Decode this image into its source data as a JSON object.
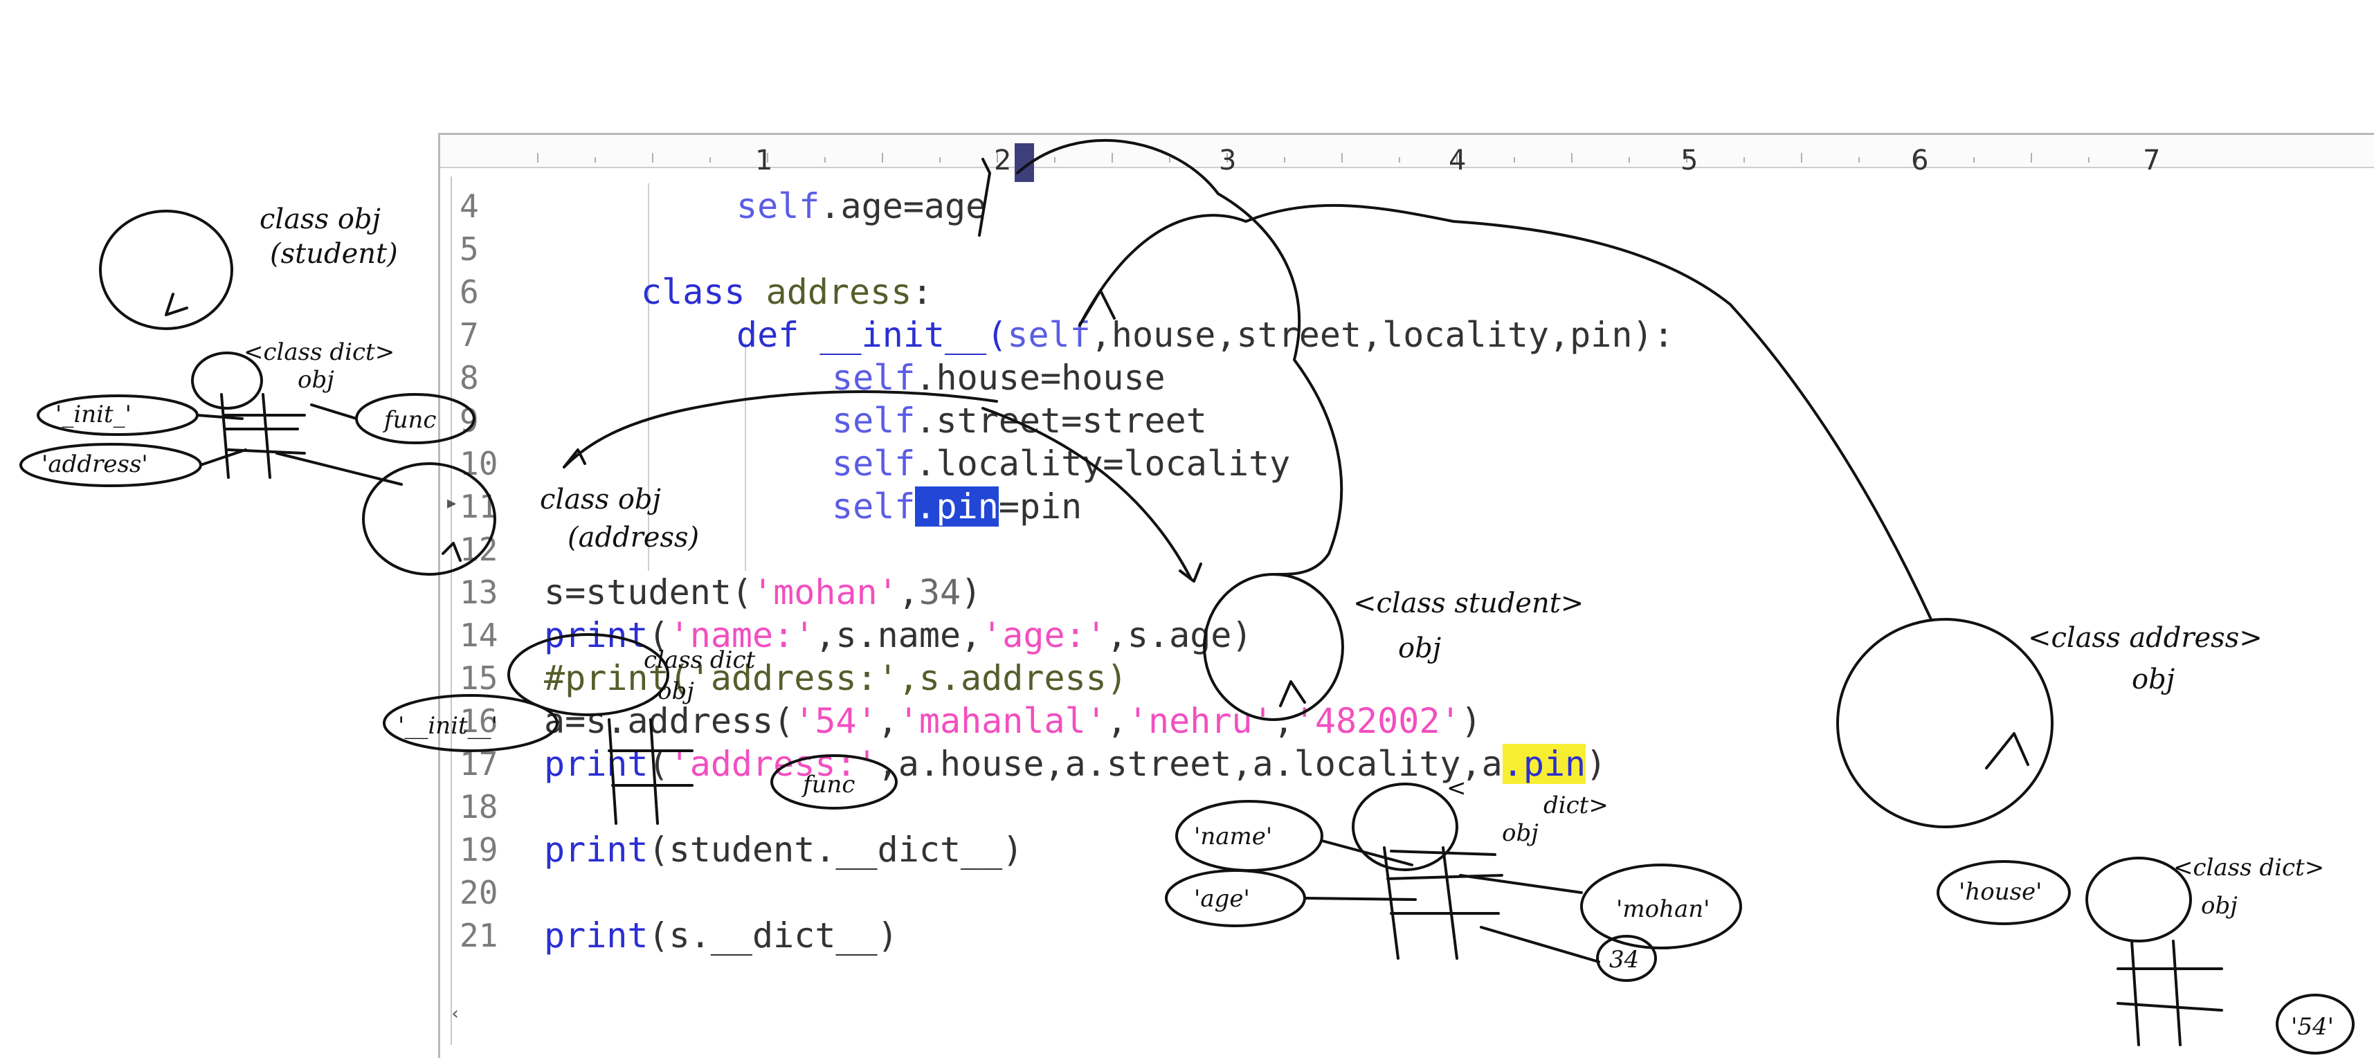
{
  "ruler": {
    "numbers": [
      "1",
      "2",
      "3",
      "4",
      "5",
      "6",
      "7"
    ]
  },
  "lines": [
    {
      "num": "4"
    },
    {
      "num": "5"
    },
    {
      "num": "6"
    },
    {
      "num": "7"
    },
    {
      "num": "8"
    },
    {
      "num": "9"
    },
    {
      "num": "10"
    },
    {
      "num": "11"
    },
    {
      "num": "12"
    },
    {
      "num": "13"
    },
    {
      "num": "14"
    },
    {
      "num": "15"
    },
    {
      "num": "16"
    },
    {
      "num": "17"
    },
    {
      "num": "18"
    },
    {
      "num": "19"
    },
    {
      "num": "20"
    },
    {
      "num": "21"
    }
  ],
  "code": {
    "l4_self": "self",
    "l4_rest": ".age=age",
    "l6_kw": "class",
    "l6_name": " address",
    "l6_colon": ":",
    "l7_kw": "def",
    "l7_name": " __init__(",
    "l7_self": "self",
    "l7_rest": ",house,street,locality,pin):",
    "l8_self": "self",
    "l8_rest": ".house=house",
    "l9_self": "self",
    "l9_rest": ".street=street",
    "l10_self": "self",
    "l10_rest": ".locality=locality",
    "l11_self": "self",
    "l11_sel": ".pin",
    "l11_rest": "=pin",
    "l13_a": "s=student(",
    "l13_s": "'mohan'",
    "l13_b": ",",
    "l13_n": "34",
    "l13_c": ")",
    "l14_kw": "print",
    "l14_a": "(",
    "l14_s1": "'name:'",
    "l14_b": ",s.name,",
    "l14_s2": "'age:'",
    "l14_c": ",s.age)",
    "l15": "#print('address:',s.address)",
    "l16_a": "a=s.address(",
    "l16_s1": "'54'",
    "l16_b": ",",
    "l16_s2": "'mahanlal'",
    "l16_c": ",",
    "l16_s3": "'nehru'",
    "l16_d": ",",
    "l16_s4": "'482002'",
    "l16_e": ")",
    "l17_kw": "print",
    "l17_a": "(",
    "l17_s": "'address:'",
    "l17_b": ",a.house,a.street,a.locality,a",
    "l17_hl": ".pin",
    "l17_c": ")",
    "l19_kw": "print",
    "l19_rest": "(student.__dict__)",
    "l21_kw": "print",
    "l21_rest": "(s.__dict__)"
  },
  "annotations": {
    "class_obj_student": [
      "class obj",
      "(student)"
    ],
    "class_dict_obj_left": [
      "<class dict>",
      "obj"
    ],
    "init_key_left": "'_init_'",
    "address_key_left": "'address'",
    "func_left": "func",
    "class_obj_address": [
      "class obj",
      "(address)"
    ],
    "class_dict_obj_mid": [
      "class dict",
      "obj"
    ],
    "init_key_mid": "'__init__'",
    "func_mid": "func",
    "class_student_obj": [
      "<class student>",
      "obj"
    ],
    "dict_obj_student": [
      "<",
      "dict>",
      "obj"
    ],
    "name_key": "'name'",
    "age_key": "'age'",
    "mohan_val": "'mohan'",
    "val_34": "34",
    "class_address_obj": [
      "<class address>",
      "obj"
    ],
    "class_dict_obj_right": [
      "<class dict>",
      "obj"
    ],
    "house_key": "'house'",
    "val_54": "'54'"
  },
  "colors": {
    "keyword": "#2a2fd2",
    "self": "#5b5de4",
    "string": "#f24fc0",
    "class_name": "#555d2b",
    "selection": "#2247d6",
    "highlight": "#f7ee32"
  }
}
